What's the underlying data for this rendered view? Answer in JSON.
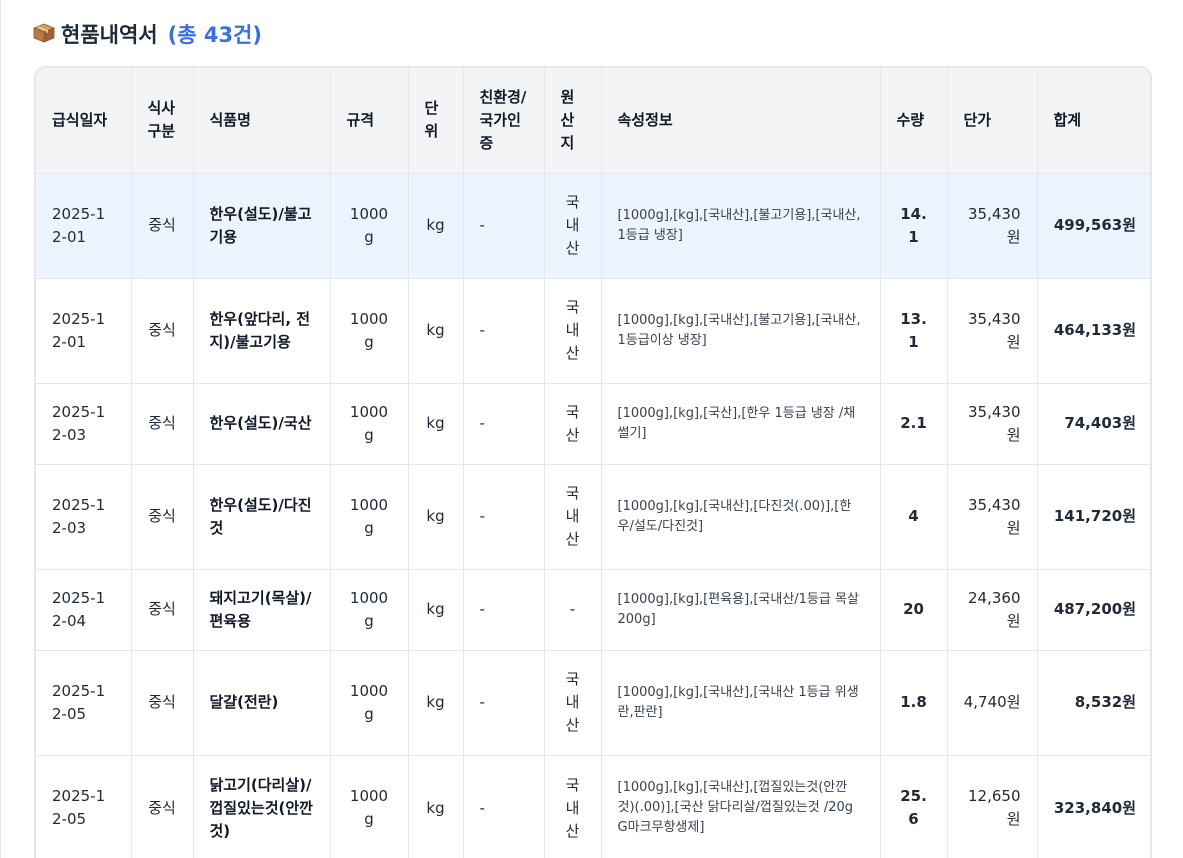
{
  "section": {
    "icon": "package-icon",
    "title": "현품내역서",
    "count": "(총 43건)",
    "accent_color": "#3b6fe0"
  },
  "table": {
    "headers": [
      "급식일자",
      "식사구분",
      "식품명",
      "규격",
      "단위",
      "친환경/국가인증",
      "원산지",
      "속성정보",
      "수량",
      "단가",
      "합계"
    ],
    "rows": [
      {
        "date": "2025-12-01",
        "meal": "중식",
        "name": "한우(설도)/불고기용",
        "spec": "1000g",
        "unit": "kg",
        "cert": "-",
        "origin": "국내산",
        "attr": "[1000g],[kg],[국내산],[불고기용],[국내산, 1등급 냉장]",
        "qty": "14.1",
        "price": "35,430원",
        "total": "499,563원"
      },
      {
        "date": "2025-12-01",
        "meal": "중식",
        "name": "한우(앞다리, 전지)/불고기용",
        "spec": "1000g",
        "unit": "kg",
        "cert": "-",
        "origin": "국내산",
        "attr": "[1000g],[kg],[국내산],[불고기용],[국내산, 1등급이상 냉장]",
        "qty": "13.1",
        "price": "35,430원",
        "total": "464,133원"
      },
      {
        "date": "2025-12-03",
        "meal": "중식",
        "name": "한우(설도)/국산",
        "spec": "1000g",
        "unit": "kg",
        "cert": "-",
        "origin": "국산",
        "attr": "[1000g],[kg],[국산],[한우 1등급 냉장 /채썰기]",
        "qty": "2.1",
        "price": "35,430원",
        "total": "74,403원"
      },
      {
        "date": "2025-12-03",
        "meal": "중식",
        "name": "한우(설도)/다진것",
        "spec": "1000g",
        "unit": "kg",
        "cert": "-",
        "origin": "국내산",
        "attr": "[1000g],[kg],[국내산],[다진것(.00)],[한우/설도/다진것]",
        "qty": "4",
        "price": "35,430원",
        "total": "141,720원"
      },
      {
        "date": "2025-12-04",
        "meal": "중식",
        "name": "돼지고기(목살)/편육용",
        "spec": "1000g",
        "unit": "kg",
        "cert": "-",
        "origin": "-",
        "attr": "[1000g],[kg],[편육용],[국내산/1등급 목살 200g]",
        "qty": "20",
        "price": "24,360원",
        "total": "487,200원"
      },
      {
        "date": "2025-12-05",
        "meal": "중식",
        "name": "달걀(전란)",
        "spec": "1000g",
        "unit": "kg",
        "cert": "-",
        "origin": "국내산",
        "attr": "[1000g],[kg],[국내산],[국내산 1등급 위생란,판란]",
        "qty": "1.8",
        "price": "4,740원",
        "total": "8,532원"
      },
      {
        "date": "2025-12-05",
        "meal": "중식",
        "name": "닭고기(다리살)/껍질있는것(안깐것)",
        "spec": "1000g",
        "unit": "kg",
        "cert": "-",
        "origin": "국내산",
        "attr": "[1000g],[kg],[국내산],[껍질있는것(안깐것)(.00)],[국산 닭다리살/껍질있는것 /20g G마크무항생제]",
        "qty": "25.6",
        "price": "12,650원",
        "total": "323,840원"
      }
    ]
  }
}
